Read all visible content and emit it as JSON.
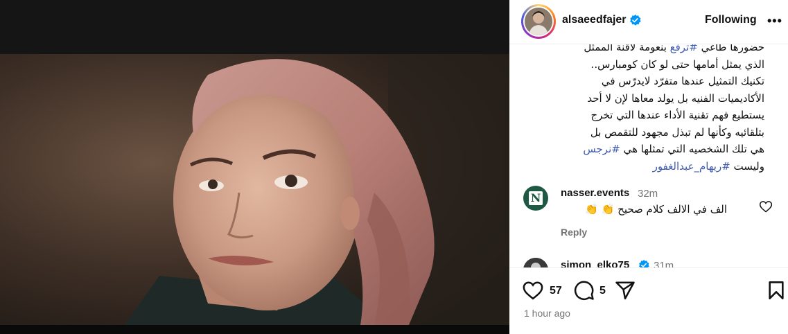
{
  "post": {
    "username": "alsaeedfajer",
    "follow_label": "Following",
    "more_label": "•••",
    "caption_lines": [
      {
        "parts": [
          {
            "text": "حضورها طاغي ",
            "tag": false
          },
          {
            "text": "#ترفع",
            "tag": true
          },
          {
            "text": " بنعومة لأقنة الممثل",
            "tag": false
          }
        ]
      },
      {
        "parts": [
          {
            "text": "الذي يمثل أمامها حتى لو كان كومبارس..",
            "tag": false
          }
        ]
      },
      {
        "parts": [
          {
            "text": "تكنيك التمثيل عندها متفرّد لايدرّس في",
            "tag": false
          }
        ]
      },
      {
        "parts": [
          {
            "text": "الأكاديميات الفنيه بل يولد معاها لإن لا أحد",
            "tag": false
          }
        ]
      },
      {
        "parts": [
          {
            "text": "يستطيع فهم تقنية الأداء عندها التي تخرج",
            "tag": false
          }
        ]
      },
      {
        "parts": [
          {
            "text": "بتلقائيه وكأنها لم تبذل مجهود للتقمص بل",
            "tag": false
          }
        ]
      },
      {
        "parts": [
          {
            "text": "هي تلك الشخصيه التي تمثلها هي ",
            "tag": false
          },
          {
            "text": "#نرجس",
            "tag": true
          }
        ]
      },
      {
        "parts": [
          {
            "text": "وليست ",
            "tag": false
          },
          {
            "text": "#ريهام_عبدالغفور",
            "tag": true
          }
        ]
      }
    ],
    "likes": "57",
    "comments_count": "5",
    "time_ago": "1 hour ago"
  },
  "comments": [
    {
      "username": "nasser.events",
      "time": "32m",
      "text": "الف في الالف كلام صحيح 👏 👏",
      "reply_label": "Reply",
      "avatar_letter": "N"
    },
    {
      "username": "simon_elko75",
      "time": "31m"
    }
  ],
  "colors": {
    "verified": "#0095f6",
    "hashtag": "#3f5ab2",
    "muted": "#737373"
  }
}
